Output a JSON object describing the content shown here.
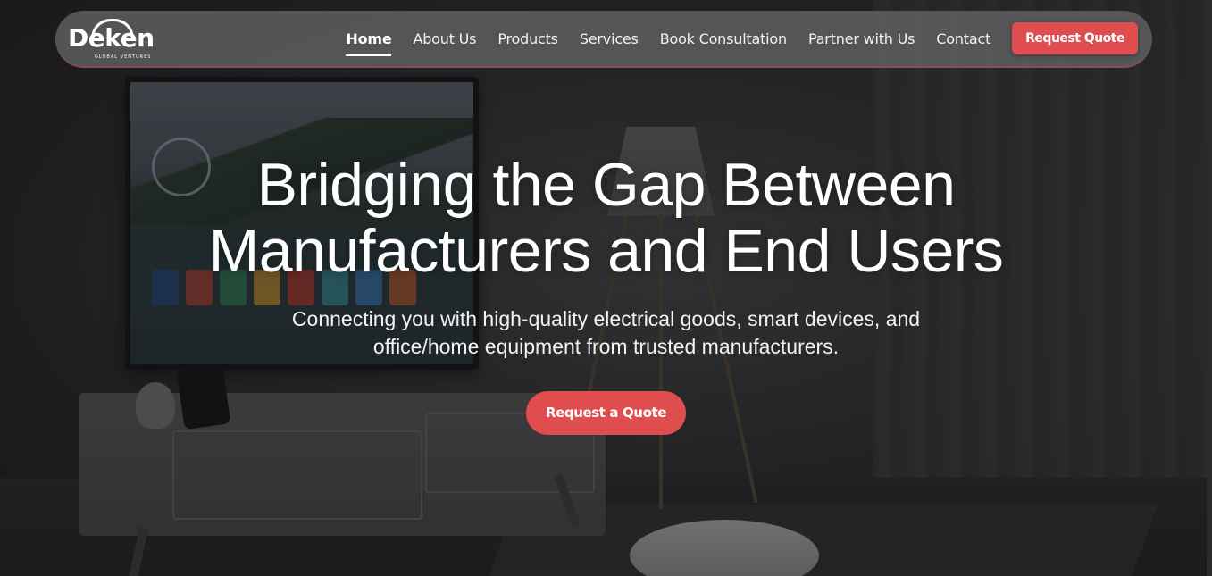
{
  "brand": {
    "logo_text": "Deken",
    "logo_subtext": "GLOBAL VENTURES"
  },
  "nav": {
    "items": [
      {
        "label": "Home",
        "active": true
      },
      {
        "label": "About Us"
      },
      {
        "label": "Products"
      },
      {
        "label": "Services"
      },
      {
        "label": "Book Consultation"
      },
      {
        "label": "Partner with Us"
      },
      {
        "label": "Contact"
      }
    ],
    "cta_label": "Request Quote"
  },
  "hero": {
    "title_line1": "Bridging the Gap Between",
    "title_line2": "Manufacturers and End Users",
    "subtitle_line1": "Connecting you with high-quality electrical goods, smart devices, and",
    "subtitle_line2": "office/home equipment from trusted manufacturers.",
    "cta_label": "Request a Quote"
  },
  "colors": {
    "accent": "#e04d4f",
    "nav_background": "#646466",
    "text": "#ffffff"
  }
}
